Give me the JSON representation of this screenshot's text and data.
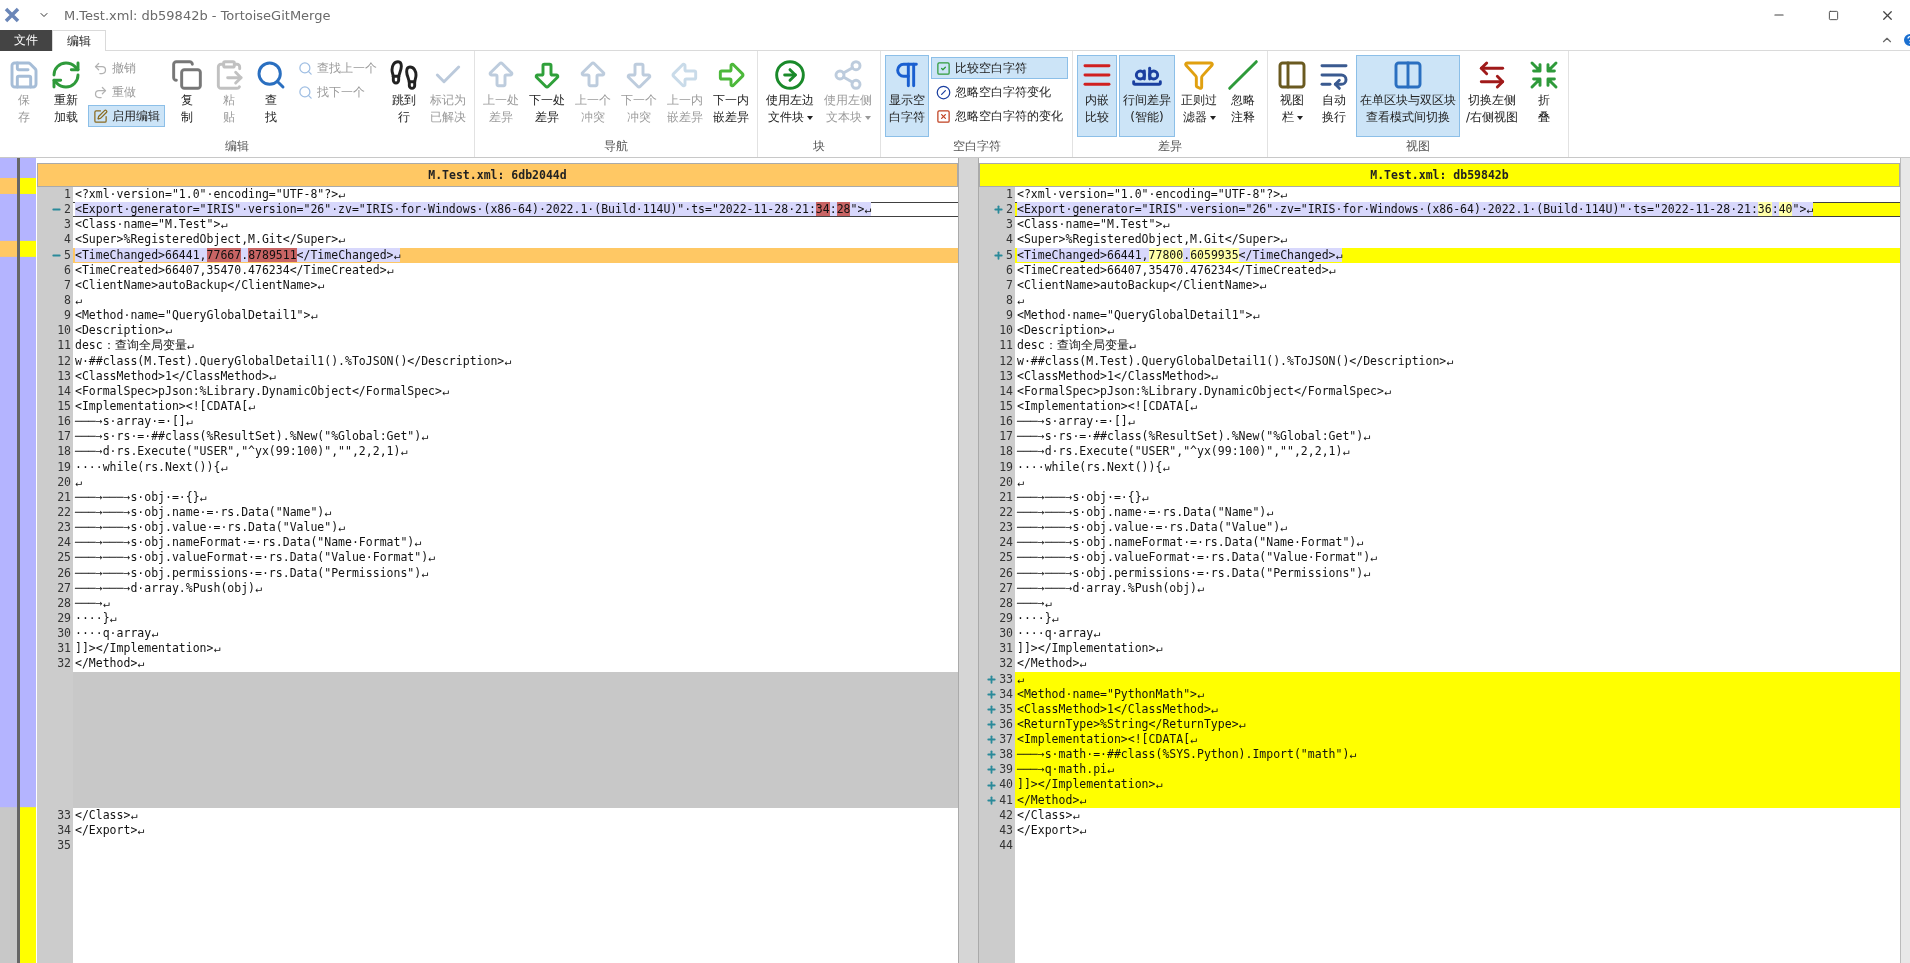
{
  "window": {
    "title": "M.Test.xml: db59842b - TortoiseGitMerge"
  },
  "ribbon": {
    "tabs": [
      {
        "label": "文件",
        "selected": false
      },
      {
        "label": "编辑",
        "selected": true
      }
    ],
    "groups": [
      {
        "title": "编辑",
        "items": [
          {
            "kind": "large",
            "label": [
              "保",
              "存"
            ],
            "disabled": true,
            "selected": false
          },
          {
            "kind": "large",
            "label": [
              "重新",
              "加载"
            ],
            "disabled": false,
            "selected": false
          },
          {
            "kind": "stack",
            "items": [
              {
                "label": "撤销",
                "disabled": true,
                "selected": false
              },
              {
                "label": "重做",
                "disabled": true,
                "selected": false
              },
              {
                "label": "启用编辑",
                "disabled": false,
                "selected": true
              }
            ]
          },
          {
            "kind": "large",
            "label": [
              "复",
              "制"
            ],
            "disabled": false,
            "selected": false
          },
          {
            "kind": "large",
            "label": [
              "粘",
              "贴"
            ],
            "disabled": true,
            "selected": false
          },
          {
            "kind": "large",
            "label": [
              "查",
              "找"
            ],
            "disabled": false,
            "selected": false
          },
          {
            "kind": "stack",
            "items": [
              {
                "label": "查找上一个",
                "disabled": true,
                "selected": false
              },
              {
                "label": "找下一个",
                "disabled": true,
                "selected": false
              }
            ]
          },
          {
            "kind": "large",
            "label": [
              "跳到",
              "行"
            ],
            "disabled": false,
            "selected": false
          },
          {
            "kind": "large",
            "label": [
              "标记为",
              "已解决"
            ],
            "disabled": true,
            "selected": false
          }
        ]
      },
      {
        "title": "导航",
        "items": [
          {
            "kind": "large",
            "label": [
              "上一处",
              "差异"
            ],
            "disabled": true,
            "selected": false
          },
          {
            "kind": "large",
            "label": [
              "下一处",
              "差异"
            ],
            "disabled": false,
            "selected": false
          },
          {
            "kind": "large",
            "label": [
              "上一个",
              "冲突"
            ],
            "disabled": true,
            "selected": false
          },
          {
            "kind": "large",
            "label": [
              "下一个",
              "冲突"
            ],
            "disabled": true,
            "selected": false
          },
          {
            "kind": "large",
            "label": [
              "上一内",
              "嵌差异"
            ],
            "disabled": true,
            "selected": false
          },
          {
            "kind": "large",
            "label": [
              "下一内",
              "嵌差异"
            ],
            "disabled": false,
            "selected": false
          }
        ]
      },
      {
        "title": "块",
        "items": [
          {
            "kind": "large",
            "label": [
              "使用左边",
              "文件块"
            ],
            "disabled": false,
            "selected": false,
            "dropdown": true
          },
          {
            "kind": "large",
            "label": [
              "使用左侧",
              "文本块"
            ],
            "disabled": true,
            "selected": false,
            "dropdown": true
          }
        ]
      },
      {
        "title": "空白字符",
        "items": [
          {
            "kind": "large",
            "label": [
              "显示空",
              "白字符"
            ],
            "disabled": false,
            "selected": true
          },
          {
            "kind": "stack",
            "items": [
              {
                "label": "比较空白字符",
                "disabled": false,
                "selected": true
              },
              {
                "label": "忽略空白字符变化",
                "disabled": false,
                "selected": false
              },
              {
                "label": "忽略空白字符的变化",
                "disabled": false,
                "selected": false
              }
            ]
          }
        ]
      },
      {
        "title": "差异",
        "items": [
          {
            "kind": "large",
            "label": [
              "内嵌",
              "比较"
            ],
            "disabled": false,
            "selected": true
          },
          {
            "kind": "large",
            "label": [
              "行间差异",
              "(智能)"
            ],
            "disabled": false,
            "selected": true
          },
          {
            "kind": "large",
            "label": [
              "正则过",
              "滤器"
            ],
            "disabled": false,
            "selected": false,
            "dropdown": true
          },
          {
            "kind": "large",
            "label": [
              "忽略",
              "注释"
            ],
            "disabled": false,
            "selected": false
          }
        ]
      },
      {
        "title": "视图",
        "items": [
          {
            "kind": "large",
            "label": [
              "视图",
              "栏"
            ],
            "disabled": false,
            "selected": false,
            "dropdown": true
          },
          {
            "kind": "large",
            "label": [
              "自动",
              "换行"
            ],
            "disabled": false,
            "selected": false
          },
          {
            "kind": "large",
            "label": [
              "在单区块与双区块",
              "查看模式间切换"
            ],
            "disabled": false,
            "selected": true
          },
          {
            "kind": "large",
            "label": [
              "切换左侧",
              "/右侧视图"
            ],
            "disabled": false,
            "selected": false
          },
          {
            "kind": "large",
            "label": [
              "折",
              "叠"
            ],
            "disabled": false,
            "selected": false
          }
        ]
      }
    ]
  },
  "panes": [
    {
      "kind": "left",
      "title": "M.Test.xml: 6db2044d",
      "color": "#ffc864",
      "lines": [
        {
          "number": "1",
          "kind": "normal",
          "selected": false,
          "text": "<?xml·version=\"1.0\"·encoding=\"UTF-8\"?>↵"
        },
        {
          "number": "2",
          "kind": "changed",
          "selected": true,
          "segments": [
            {
              "text": "<Export·generator=\"IRIS\"·version=\"26\"·zv=\"IRIS·for·Windows·(x86-64)·2022.1·(Build·114U)\"·ts=\"2022-11-28·21:",
              "diff": false
            },
            {
              "text": "34",
              "diff": true
            },
            {
              "text": ":",
              "diff": false
            },
            {
              "text": "28",
              "diff": true
            },
            {
              "text": "\">↵",
              "diff": false
            }
          ]
        },
        {
          "number": "3",
          "kind": "normal",
          "selected": false,
          "text": "<Class·name=\"M.Test\">↵"
        },
        {
          "number": "4",
          "kind": "normal",
          "selected": false,
          "text": "<Super>%RegisteredObject,M.Git</Super>↵"
        },
        {
          "number": "5",
          "kind": "changed",
          "selected": false,
          "segments": [
            {
              "text": "<TimeChanged>66441,",
              "diff": false
            },
            {
              "text": "77667",
              "diff": true
            },
            {
              "text": ".",
              "diff": false
            },
            {
              "text": "8789511",
              "diff": true
            },
            {
              "text": "</TimeChanged>↵",
              "diff": false
            }
          ]
        },
        {
          "number": "6",
          "kind": "normal",
          "selected": false,
          "text": "<TimeCreated>66407,35470.476234</TimeCreated>↵"
        },
        {
          "number": "7",
          "kind": "normal",
          "selected": false,
          "text": "<ClientName>autoBackup</ClientName>↵"
        },
        {
          "number": "8",
          "kind": "normal",
          "selected": false,
          "text": "↵"
        },
        {
          "number": "9",
          "kind": "normal",
          "selected": false,
          "text": "<Method·name=\"QueryGlobalDetail1\">↵"
        },
        {
          "number": "10",
          "kind": "normal",
          "selected": false,
          "text": "<Description>↵"
        },
        {
          "number": "11",
          "kind": "normal",
          "selected": false,
          "text": "desc：查询全局变量↵"
        },
        {
          "number": "12",
          "kind": "normal",
          "selected": false,
          "text": "w·##class(M.Test).QueryGlobalDetail1().%ToJSON()</Description>↵"
        },
        {
          "number": "13",
          "kind": "normal",
          "selected": false,
          "text": "<ClassMethod>1</ClassMethod>↵"
        },
        {
          "number": "14",
          "kind": "normal",
          "selected": false,
          "text": "<FormalSpec>pJson:%Library.DynamicObject</FormalSpec>↵"
        },
        {
          "number": "15",
          "kind": "normal",
          "selected": false,
          "text": "<Implementation><![CDATA[↵"
        },
        {
          "number": "16",
          "kind": "normal",
          "selected": false,
          "text": "───→s·array·=·[]↵"
        },
        {
          "number": "17",
          "kind": "normal",
          "selected": false,
          "text": "───→s·rs·=·##class(%ResultSet).%New(\"%Global:Get\")↵"
        },
        {
          "number": "18",
          "kind": "normal",
          "selected": false,
          "text": "───→d·rs.Execute(\"USER\",\"^yx(99:100)\",\"\",2,2,1)↵"
        },
        {
          "number": "19",
          "kind": "normal",
          "selected": false,
          "text": "····while(rs.Next()){↵"
        },
        {
          "number": "20",
          "kind": "normal",
          "selected": false,
          "text": "↵"
        },
        {
          "number": "21",
          "kind": "normal",
          "selected": false,
          "text": "───→───→s·obj·=·{}↵"
        },
        {
          "number": "22",
          "kind": "normal",
          "selected": false,
          "text": "───→───→s·obj.name·=·rs.Data(\"Name\")↵"
        },
        {
          "number": "23",
          "kind": "normal",
          "selected": false,
          "text": "───→───→s·obj.value·=·rs.Data(\"Value\")↵"
        },
        {
          "number": "24",
          "kind": "normal",
          "selected": false,
          "text": "───→───→s·obj.nameFormat·=·rs.Data(\"Name·Format\")↵"
        },
        {
          "number": "25",
          "kind": "normal",
          "selected": false,
          "text": "───→───→s·obj.valueFormat·=·rs.Data(\"Value·Format\")↵"
        },
        {
          "number": "26",
          "kind": "normal",
          "selected": false,
          "text": "───→───→s·obj.permissions·=·rs.Data(\"Permissions\")↵"
        },
        {
          "number": "27",
          "kind": "normal",
          "selected": false,
          "text": "───→───→d·array.%Push(obj)↵"
        },
        {
          "number": "28",
          "kind": "normal",
          "selected": false,
          "text": "───→↵"
        },
        {
          "number": "29",
          "kind": "normal",
          "selected": false,
          "text": "····}↵"
        },
        {
          "number": "30",
          "kind": "normal",
          "selected": false,
          "text": "····q·array↵"
        },
        {
          "number": "31",
          "kind": "normal",
          "selected": false,
          "text": "]]></Implementation>↵"
        },
        {
          "number": "32",
          "kind": "normal",
          "selected": false,
          "text": "</Method>↵"
        },
        {
          "kind": "filler",
          "selected": false
        },
        {
          "kind": "filler",
          "selected": false
        },
        {
          "kind": "filler",
          "selected": false
        },
        {
          "kind": "filler",
          "selected": false
        },
        {
          "kind": "filler",
          "selected": false
        },
        {
          "kind": "filler",
          "selected": false
        },
        {
          "kind": "filler",
          "selected": false
        },
        {
          "kind": "filler",
          "selected": false
        },
        {
          "kind": "filler",
          "selected": false
        },
        {
          "number": "33",
          "kind": "normal",
          "selected": false,
          "text": "</Class>↵"
        },
        {
          "number": "34",
          "kind": "normal",
          "selected": false,
          "text": "</Export>↵"
        },
        {
          "number": "35",
          "kind": "normal",
          "selected": false
        }
      ]
    },
    {
      "kind": "right",
      "title": "M.Test.xml: db59842b",
      "color": "#ffff00",
      "lines": [
        {
          "number": "1",
          "kind": "normal",
          "selected": false,
          "text": "<?xml·version=\"1.0\"·encoding=\"UTF-8\"?>↵"
        },
        {
          "number": "2",
          "kind": "changed",
          "selected": true,
          "segments": [
            {
              "text": "<Export·generator=\"IRIS\"·version=\"26\"·zv=\"IRIS·for·Windows·(x86-64)·2022.1·(Build·114U)\"·ts=\"2022-11-28·21:",
              "diff": false
            },
            {
              "text": "36",
              "diff": true
            },
            {
              "text": ":",
              "diff": false
            },
            {
              "text": "40",
              "diff": true
            },
            {
              "text": "\">↵",
              "diff": false
            }
          ]
        },
        {
          "number": "3",
          "kind": "normal",
          "selected": false,
          "text": "<Class·name=\"M.Test\">↵"
        },
        {
          "number": "4",
          "kind": "normal",
          "selected": false,
          "text": "<Super>%RegisteredObject,M.Git</Super>↵"
        },
        {
          "number": "5",
          "kind": "changed",
          "selected": false,
          "segments": [
            {
              "text": "<TimeChanged>66441,",
              "diff": false
            },
            {
              "text": "77800",
              "diff": true
            },
            {
              "text": ".",
              "diff": false
            },
            {
              "text": "6059935",
              "diff": true
            },
            {
              "text": "</TimeChanged>↵",
              "diff": false
            }
          ]
        },
        {
          "number": "6",
          "kind": "normal",
          "selected": false,
          "text": "<TimeCreated>66407,35470.476234</TimeCreated>↵"
        },
        {
          "number": "7",
          "kind": "normal",
          "selected": false,
          "text": "<ClientName>autoBackup</ClientName>↵"
        },
        {
          "number": "8",
          "kind": "normal",
          "selected": false,
          "text": "↵"
        },
        {
          "number": "9",
          "kind": "normal",
          "selected": false,
          "text": "<Method·name=\"QueryGlobalDetail1\">↵"
        },
        {
          "number": "10",
          "kind": "normal",
          "selected": false,
          "text": "<Description>↵"
        },
        {
          "number": "11",
          "kind": "normal",
          "selected": false,
          "text": "desc：查询全局变量↵"
        },
        {
          "number": "12",
          "kind": "normal",
          "selected": false,
          "text": "w·##class(M.Test).QueryGlobalDetail1().%ToJSON()</Description>↵"
        },
        {
          "number": "13",
          "kind": "normal",
          "selected": false,
          "text": "<ClassMethod>1</ClassMethod>↵"
        },
        {
          "number": "14",
          "kind": "normal",
          "selected": false,
          "text": "<FormalSpec>pJson:%Library.DynamicObject</FormalSpec>↵"
        },
        {
          "number": "15",
          "kind": "normal",
          "selected": false,
          "text": "<Implementation><![CDATA[↵"
        },
        {
          "number": "16",
          "kind": "normal",
          "selected": false,
          "text": "───→s·array·=·[]↵"
        },
        {
          "number": "17",
          "kind": "normal",
          "selected": false,
          "text": "───→s·rs·=·##class(%ResultSet).%New(\"%Global:Get\")↵"
        },
        {
          "number": "18",
          "kind": "normal",
          "selected": false,
          "text": "───→d·rs.Execute(\"USER\",\"^yx(99:100)\",\"\",2,2,1)↵"
        },
        {
          "number": "19",
          "kind": "normal",
          "selected": false,
          "text": "····while(rs.Next()){↵"
        },
        {
          "number": "20",
          "kind": "normal",
          "selected": false,
          "text": "↵"
        },
        {
          "number": "21",
          "kind": "normal",
          "selected": false,
          "text": "───→───→s·obj·=·{}↵"
        },
        {
          "number": "22",
          "kind": "normal",
          "selected": false,
          "text": "───→───→s·obj.name·=·rs.Data(\"Name\")↵"
        },
        {
          "number": "23",
          "kind": "normal",
          "selected": false,
          "text": "───→───→s·obj.value·=·rs.Data(\"Value\")↵"
        },
        {
          "number": "24",
          "kind": "normal",
          "selected": false,
          "text": "───→───→s·obj.nameFormat·=·rs.Data(\"Name·Format\")↵"
        },
        {
          "number": "25",
          "kind": "normal",
          "selected": false,
          "text": "───→───→s·obj.valueFormat·=·rs.Data(\"Value·Format\")↵"
        },
        {
          "number": "26",
          "kind": "normal",
          "selected": false,
          "text": "───→───→s·obj.permissions·=·rs.Data(\"Permissions\")↵"
        },
        {
          "number": "27",
          "kind": "normal",
          "selected": false,
          "text": "───→───→d·array.%Push(obj)↵"
        },
        {
          "number": "28",
          "kind": "normal",
          "selected": false,
          "text": "───→↵"
        },
        {
          "number": "29",
          "kind": "normal",
          "selected": false,
          "text": "····}↵"
        },
        {
          "number": "30",
          "kind": "normal",
          "selected": false,
          "text": "····q·array↵"
        },
        {
          "number": "31",
          "kind": "normal",
          "selected": false,
          "text": "]]></Implementation>↵"
        },
        {
          "number": "32",
          "kind": "normal",
          "selected": false,
          "text": "</Method>↵"
        },
        {
          "number": "33",
          "kind": "added",
          "selected": false,
          "text": "↵"
        },
        {
          "number": "34",
          "kind": "added",
          "selected": false,
          "text": "<Method·name=\"PythonMath\">↵"
        },
        {
          "number": "35",
          "kind": "added",
          "selected": false,
          "text": "<ClassMethod>1</ClassMethod>↵"
        },
        {
          "number": "36",
          "kind": "added",
          "selected": false,
          "text": "<ReturnType>%String</ReturnType>↵"
        },
        {
          "number": "37",
          "kind": "added",
          "selected": false,
          "text": "<Implementation><![CDATA[↵"
        },
        {
          "number": "38",
          "kind": "added",
          "selected": false,
          "text": "───→s·math·=·##class(%SYS.Python).Import(\"math\")↵"
        },
        {
          "number": "39",
          "kind": "added",
          "selected": false,
          "text": "───→q·math.pi↵"
        },
        {
          "number": "40",
          "kind": "added",
          "selected": false,
          "text": "]]></Implementation>↵"
        },
        {
          "number": "41",
          "kind": "added",
          "selected": false,
          "text": "</Method>↵"
        },
        {
          "number": "42",
          "kind": "normal",
          "selected": false,
          "text": "</Class>↵"
        },
        {
          "number": "43",
          "kind": "normal",
          "selected": false,
          "text": "</Export>↵"
        },
        {
          "number": "44",
          "kind": "normal",
          "selected": false
        }
      ]
    }
  ]
}
